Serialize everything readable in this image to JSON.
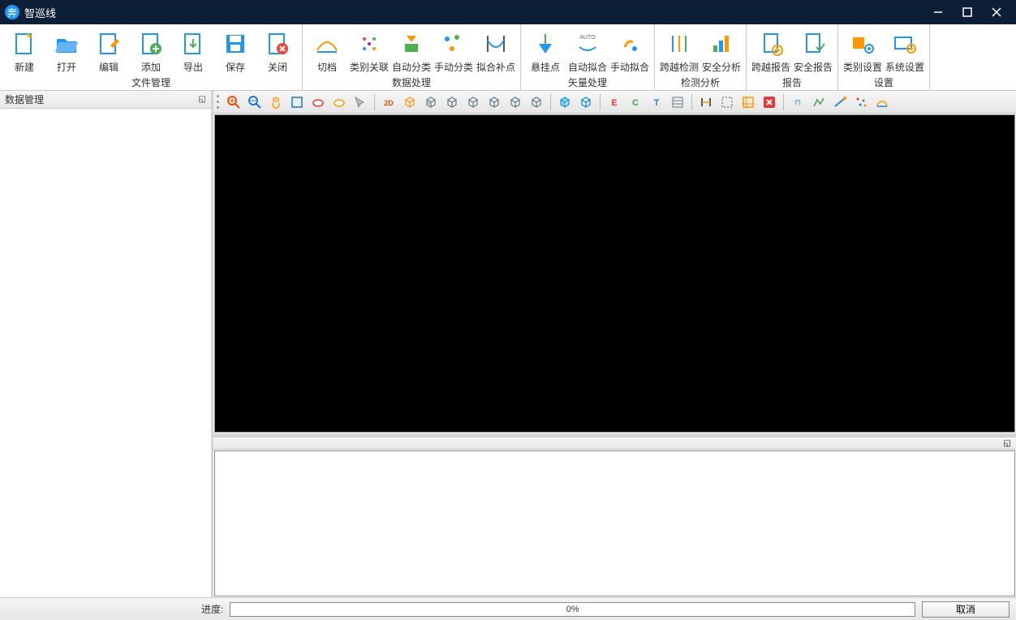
{
  "app": {
    "title": "智巡线"
  },
  "ribbon": {
    "groups": [
      {
        "label": "文件管理",
        "buttons": [
          {
            "name": "new",
            "label": "新建"
          },
          {
            "name": "open",
            "label": "打开"
          },
          {
            "name": "edit",
            "label": "编辑"
          },
          {
            "name": "add",
            "label": "添加"
          },
          {
            "name": "export",
            "label": "导出"
          },
          {
            "name": "save",
            "label": "保存"
          },
          {
            "name": "close",
            "label": "关闭"
          }
        ]
      },
      {
        "label": "数据处理",
        "buttons": [
          {
            "name": "cut-segment",
            "label": "切档"
          },
          {
            "name": "category-link",
            "label": "类别关联"
          },
          {
            "name": "auto-classify",
            "label": "自动分类"
          },
          {
            "name": "manual-classify",
            "label": "手动分类"
          },
          {
            "name": "fit-fill",
            "label": "拟合补点"
          }
        ]
      },
      {
        "label": "矢量处理",
        "buttons": [
          {
            "name": "hang-point",
            "label": "悬挂点"
          },
          {
            "name": "auto-fit",
            "label": "自动拟合"
          },
          {
            "name": "manual-fit",
            "label": "手动拟合"
          }
        ]
      },
      {
        "label": "检测分析",
        "buttons": [
          {
            "name": "cross-detect",
            "label": "跨越检测"
          },
          {
            "name": "safety-analysis",
            "label": "安全分析"
          }
        ]
      },
      {
        "label": "报告",
        "buttons": [
          {
            "name": "cross-report",
            "label": "跨越报告"
          },
          {
            "name": "safety-report",
            "label": "安全报告"
          }
        ]
      },
      {
        "label": "设置",
        "buttons": [
          {
            "name": "category-settings",
            "label": "类别设置"
          },
          {
            "name": "system-settings",
            "label": "系统设置"
          }
        ]
      }
    ]
  },
  "leftPanel": {
    "title": "数据管理"
  },
  "toolbar": {
    "items": [
      "zoom-in",
      "zoom-out",
      "pan",
      "fit",
      "cloud1",
      "cloud2",
      "pick",
      "|",
      "view-2d",
      "view-3d",
      "cube-front",
      "cube-back",
      "cube-left",
      "cube-right",
      "cube-top",
      "cube-iso",
      "|",
      "box1",
      "box2",
      "|",
      "edl-e",
      "edl-c",
      "edl-t",
      "grid",
      "|",
      "ruler",
      "select-rect",
      "select-crop",
      "delete",
      "|",
      "measure",
      "profile",
      "slope",
      "scatter",
      "dome"
    ]
  },
  "status": {
    "progress_label": "进度:",
    "progress_value": "0%",
    "cancel_label": "取消"
  }
}
